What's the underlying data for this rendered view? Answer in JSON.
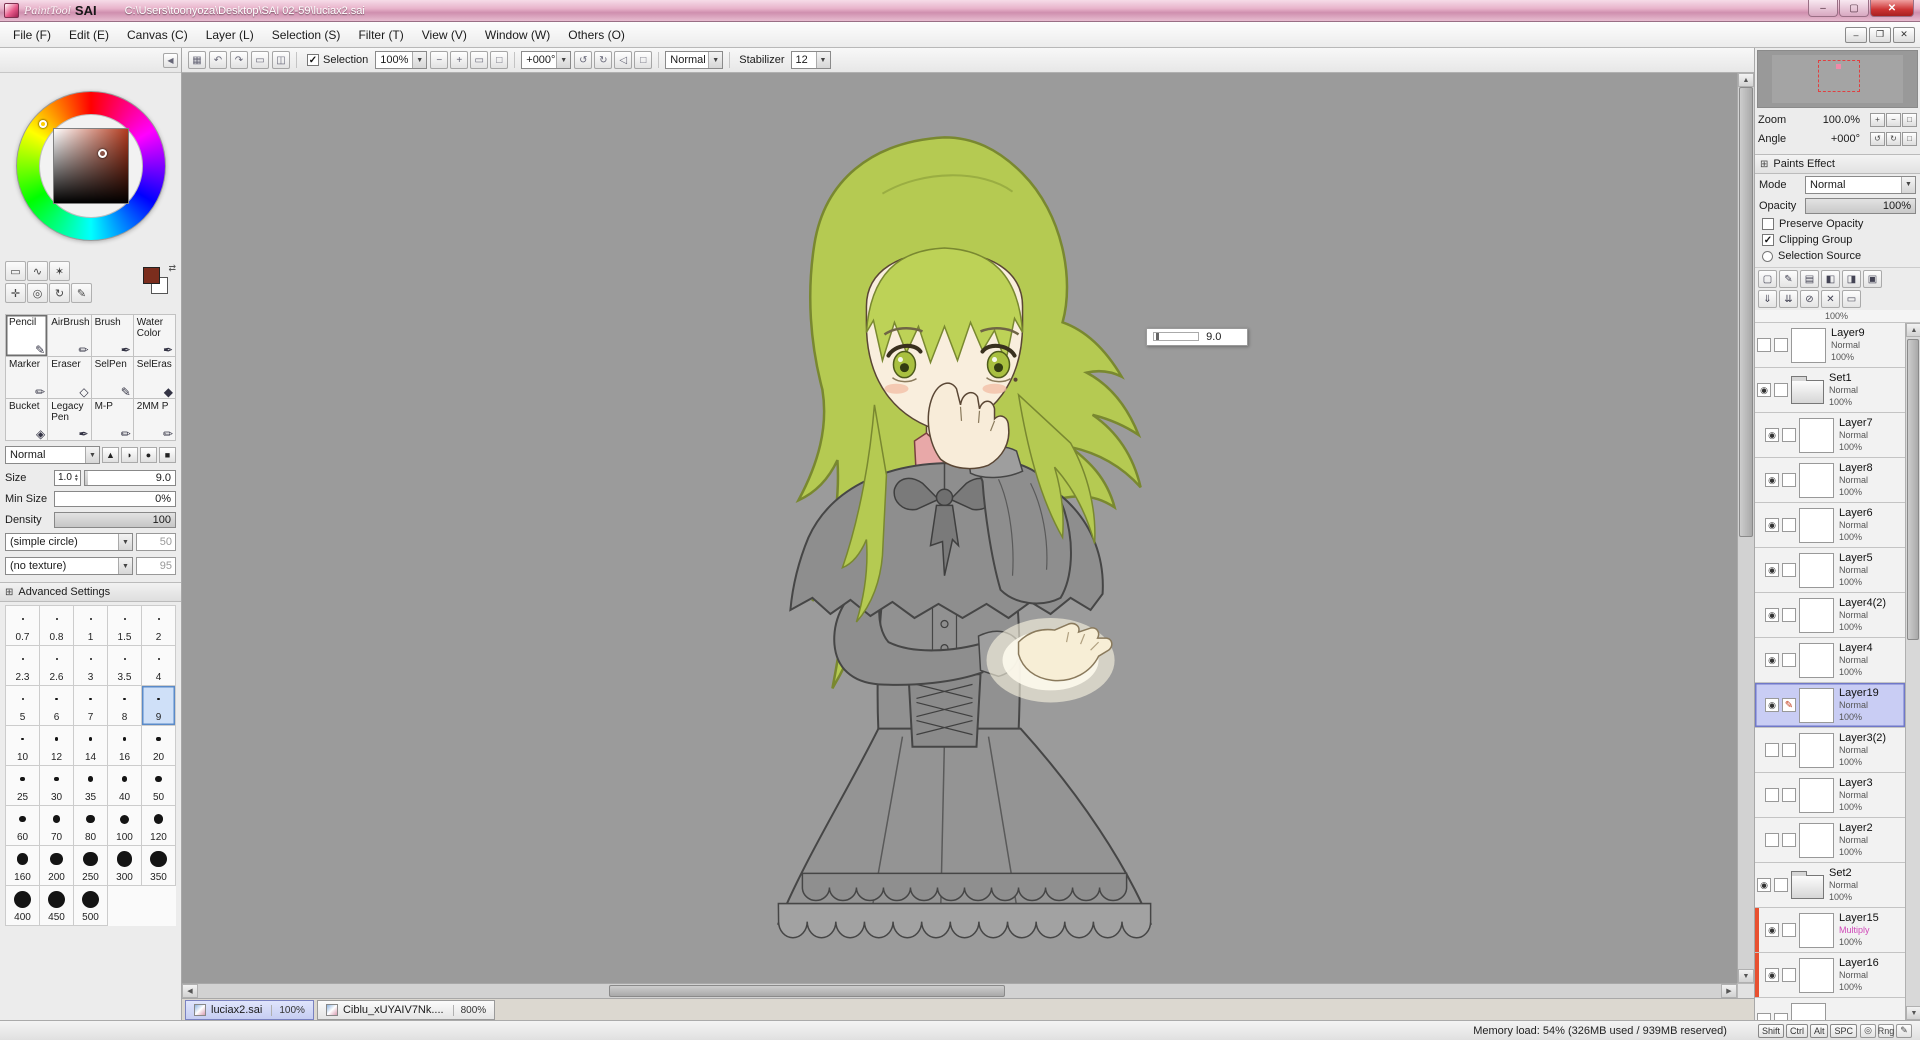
{
  "colors": {
    "accent_selection": "#c9cdf4",
    "clip_stripe": "#e85030",
    "multiply_mode_text": "#d048b8",
    "titlebar_pink": "#e8b4cb",
    "canvas_gray": "#9b9b9b",
    "foreground_swatch": "#7b2d1d",
    "hair_green": "#b5ca52"
  },
  "icons": {
    "minimize": "–",
    "maximize": "▢",
    "close": "✕",
    "check": "✓",
    "dropdown": "▼",
    "up": "▲",
    "down": "▼",
    "left": "◀",
    "right": "▶",
    "eye": "◉",
    "pencil": "✎",
    "expand": "⊞",
    "swap": "⇄"
  },
  "titlebar": {
    "logo_painttool": "PaintTool",
    "logo_sai": "SAI",
    "path": "C:\\Users\\toonyoza\\Desktop\\SAI 02-59\\luciax2.sai"
  },
  "menubar": {
    "items": [
      "File (F)",
      "Edit (E)",
      "Canvas (C)",
      "Layer (L)",
      "Selection (S)",
      "Filter (T)",
      "View (V)",
      "Window (W)",
      "Others (O)"
    ],
    "mdi_buttons": [
      {
        "name": "child-minimize-button",
        "glyph": "–"
      },
      {
        "name": "child-restore-button",
        "glyph": "❐"
      },
      {
        "name": "child-close-button",
        "glyph": "✕"
      }
    ]
  },
  "toolbar": {
    "nav_icons": [
      {
        "name": "scroll-view-button",
        "glyph": "▦"
      },
      {
        "name": "undo-button",
        "glyph": "↶"
      },
      {
        "name": "redo-button",
        "glyph": "↷"
      },
      {
        "name": "deselect-button",
        "glyph": "▭"
      },
      {
        "name": "invert-selection-button",
        "glyph": "◫"
      }
    ],
    "selection_label": "Selection",
    "selection_checked": true,
    "zoom_value": "100%",
    "zoom_buttons": [
      {
        "name": "zoom-out-button",
        "glyph": "−"
      },
      {
        "name": "zoom-in-button",
        "glyph": "+"
      },
      {
        "name": "zoom-fit-button",
        "glyph": "▭"
      },
      {
        "name": "zoom-reset-button",
        "glyph": "□"
      }
    ],
    "angle_value": "+000°",
    "angle_buttons": [
      {
        "name": "rotate-ccw-button",
        "glyph": "↺"
      },
      {
        "name": "rotate-cw-button",
        "glyph": "↻"
      },
      {
        "name": "flip-horizontal-button",
        "glyph": "◁"
      },
      {
        "name": "angle-reset-button",
        "glyph": "□"
      }
    ],
    "mode_value": "Normal",
    "stabilizer_label": "Stabilizer",
    "stabilizer_value": "12"
  },
  "left_panel": {
    "mini_tools_row1": [
      {
        "name": "rect-select-tool",
        "glyph": "▭"
      },
      {
        "name": "lasso-select-tool",
        "glyph": "∿"
      },
      {
        "name": "magic-wand-tool",
        "glyph": "✶"
      }
    ],
    "mini_tools_row2": [
      {
        "name": "move-tool",
        "glyph": "✛"
      },
      {
        "name": "zoom-tool",
        "glyph": "◎"
      },
      {
        "name": "rotate-canvas-tool",
        "glyph": "↻"
      },
      {
        "name": "eyedropper-tool",
        "glyph": "✎"
      }
    ],
    "tools": [
      {
        "label": "Pencil",
        "glyph": "✎",
        "selected": true
      },
      {
        "label": "AirBrush",
        "glyph": "✏"
      },
      {
        "label": "Brush",
        "glyph": "✒"
      },
      {
        "label": "Water Color",
        "glyph": "✒"
      },
      {
        "label": "Marker",
        "glyph": "✏"
      },
      {
        "label": "Eraser",
        "glyph": "◇"
      },
      {
        "label": "SelPen",
        "glyph": "✎"
      },
      {
        "label": "SelEras",
        "glyph": "◆"
      },
      {
        "label": "Bucket",
        "glyph": "◈"
      },
      {
        "label": "Legacy Pen",
        "glyph": "✒"
      },
      {
        "label": "M-P",
        "glyph": "✏"
      },
      {
        "label": "2MM P",
        "glyph": "✏"
      }
    ],
    "blend_mode": "Normal",
    "tip_shapes": [
      "▲",
      "◗",
      "●",
      "■"
    ],
    "size_label": "Size",
    "size_unit": "1.0",
    "size_value": "9.0",
    "minsize_label": "Min Size",
    "minsize_value": "0%",
    "density_label": "Density",
    "density_value": "100",
    "edge_shape": "(simple circle)",
    "edge_value": "50",
    "texture": "(no texture)",
    "texture_value": "95",
    "advanced_label": "Advanced Settings",
    "brush_sizes": [
      "0.7",
      "0.8",
      "1",
      "1.5",
      "2",
      "2.3",
      "2.6",
      "3",
      "3.5",
      "4",
      "5",
      "6",
      "7",
      "8",
      "9",
      "10",
      "12",
      "14",
      "16",
      "20",
      "25",
      "30",
      "35",
      "40",
      "50",
      "60",
      "70",
      "80",
      "100",
      "120",
      "160",
      "200",
      "250",
      "300",
      "350",
      "400",
      "450",
      "500"
    ],
    "selected_size": "9"
  },
  "canvas": {
    "tooltip_value": "9.0"
  },
  "right_panel": {
    "zoom_label": "Zoom",
    "zoom_value": "100.0%",
    "zoom_buttons": [
      {
        "name": "nav-zoom-in-button",
        "glyph": "+"
      },
      {
        "name": "nav-zoom-out-button",
        "glyph": "−"
      },
      {
        "name": "nav-zoom-reset-button",
        "glyph": "□"
      }
    ],
    "angle_label": "Angle",
    "angle_value": "+000°",
    "angle_buttons": [
      {
        "name": "nav-rotate-ccw-button",
        "glyph": "↺"
      },
      {
        "name": "nav-rotate-cw-button",
        "glyph": "↻"
      },
      {
        "name": "nav-angle-reset-button",
        "glyph": "□"
      }
    ],
    "paints_effect_label": "Paints Effect",
    "mode_label": "Mode",
    "mode_value": "Normal",
    "opacity_label": "Opacity",
    "opacity_value": "100%",
    "preserve_opacity_label": "Preserve Opacity",
    "preserve_opacity_checked": false,
    "clipping_group_label": "Clipping Group",
    "clipping_group_checked": true,
    "selection_source_label": "Selection Source",
    "layer_icons_row1": [
      {
        "name": "new-layer-button",
        "glyph": "▢"
      },
      {
        "name": "new-linework-layer-button",
        "glyph": "✎"
      },
      {
        "name": "new-layer-set-button",
        "glyph": "▤"
      },
      {
        "name": "layer-mask-button",
        "glyph": "◧"
      },
      {
        "name": "special-layer-button",
        "glyph": "◨"
      },
      {
        "name": "paints-effect-button",
        "glyph": "▣"
      }
    ],
    "layer_icons_row2": [
      {
        "name": "transfer-down-button",
        "glyph": "⇓"
      },
      {
        "name": "merge-down-button",
        "glyph": "⇊"
      },
      {
        "name": "clear-layer-button",
        "glyph": "⊘"
      },
      {
        "name": "delete-layer-button",
        "glyph": "✕"
      },
      {
        "name": "lock-layer-button",
        "glyph": "▭"
      }
    ],
    "partial_row_opacity": "100%",
    "layers": [
      {
        "name": "Layer9",
        "mode": "Normal",
        "opacity": "100%",
        "type": "layer",
        "eye": false,
        "indent": false
      },
      {
        "name": "Set1",
        "mode": "Normal",
        "opacity": "100%",
        "type": "folder",
        "eye": true,
        "indent": false
      },
      {
        "name": "Layer7",
        "mode": "Normal",
        "opacity": "100%",
        "type": "layer",
        "eye": true,
        "indent": true
      },
      {
        "name": "Layer8",
        "mode": "Normal",
        "opacity": "100%",
        "type": "layer",
        "eye": true,
        "indent": true
      },
      {
        "name": "Layer6",
        "mode": "Normal",
        "opacity": "100%",
        "type": "layer",
        "eye": true,
        "indent": true
      },
      {
        "name": "Layer5",
        "mode": "Normal",
        "opacity": "100%",
        "type": "layer",
        "eye": true,
        "indent": true
      },
      {
        "name": "Layer4(2)",
        "mode": "Normal",
        "opacity": "100%",
        "type": "layer",
        "eye": true,
        "indent": true
      },
      {
        "name": "Layer4",
        "mode": "Normal",
        "opacity": "100%",
        "type": "layer",
        "eye": true,
        "indent": true
      },
      {
        "name": "Layer19",
        "mode": "Normal",
        "opacity": "100%",
        "type": "layer",
        "eye": true,
        "indent": true,
        "selected": true,
        "pencil": true
      },
      {
        "name": "Layer3(2)",
        "mode": "Normal",
        "opacity": "100%",
        "type": "layer",
        "eye": false,
        "indent": true
      },
      {
        "name": "Layer3",
        "mode": "Normal",
        "opacity": "100%",
        "type": "layer",
        "eye": false,
        "indent": true
      },
      {
        "name": "Layer2",
        "mode": "Normal",
        "opacity": "100%",
        "type": "layer",
        "eye": false,
        "indent": true
      },
      {
        "name": "Set2",
        "mode": "Normal",
        "opacity": "100%",
        "type": "folder",
        "eye": true,
        "indent": false
      },
      {
        "name": "Layer15",
        "mode": "Multiply",
        "opacity": "100%",
        "type": "layer",
        "eye": true,
        "indent": true,
        "clip": true
      },
      {
        "name": "Layer16",
        "mode": "Normal",
        "opacity": "100%",
        "type": "layer",
        "eye": true,
        "indent": true,
        "clip": true
      }
    ]
  },
  "tabbar": {
    "tabs": [
      {
        "title": "luciax2.sai",
        "zoom": "100%",
        "active": true
      },
      {
        "title": "Ciblu_xUYAIV7Nk....",
        "zoom": "800%",
        "active": false
      }
    ]
  },
  "statusbar": {
    "memory_text": "Memory load: 54% (326MB used / 939MB reserved)",
    "key_badges": [
      "Shift",
      "Ctrl",
      "Alt",
      "SPC"
    ],
    "status_icons": [
      {
        "name": "snap-indicator-icon",
        "glyph": "◎"
      },
      {
        "name": "rng-indicator",
        "glyph": "Rng"
      },
      {
        "name": "pen-pressure-icon",
        "glyph": "✎"
      }
    ]
  }
}
